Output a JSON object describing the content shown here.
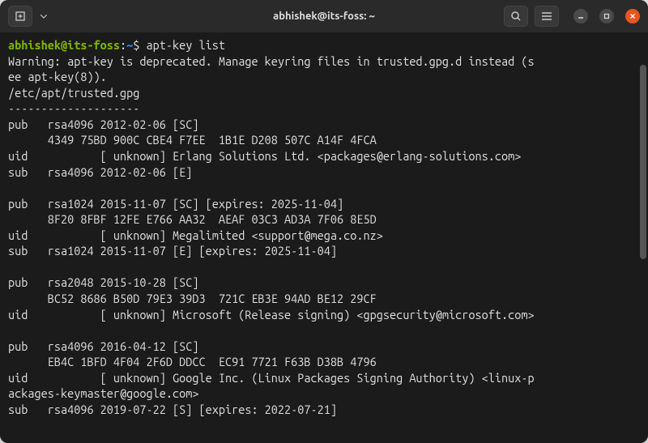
{
  "window": {
    "title": "abhishek@its-foss: ~"
  },
  "prompt": {
    "user_host": "abhishek@its-foss",
    "sep": ":",
    "path": "~",
    "dollar": "$"
  },
  "command": "apt-key list",
  "output_lines": [
    "Warning: apt-key is deprecated. Manage keyring files in trusted.gpg.d instead (s",
    "ee apt-key(8)).",
    "/etc/apt/trusted.gpg",
    "--------------------",
    "pub   rsa4096 2012-02-06 [SC]",
    "      4349 75BD 900C CBE4 F7EE  1B1E D208 507C A14F 4FCA",
    "uid           [ unknown] Erlang Solutions Ltd. <packages@erlang-solutions.com>",
    "sub   rsa4096 2012-02-06 [E]",
    "",
    "pub   rsa1024 2015-11-07 [SC] [expires: 2025-11-04]",
    "      8F20 8FBF 12FE E766 AA32  AEAF 03C3 AD3A 7F06 8E5D",
    "uid           [ unknown] Megalimited <support@mega.co.nz>",
    "sub   rsa1024 2015-11-07 [E] [expires: 2025-11-04]",
    "",
    "pub   rsa2048 2015-10-28 [SC]",
    "      BC52 8686 B50D 79E3 39D3  721C EB3E 94AD BE12 29CF",
    "uid           [ unknown] Microsoft (Release signing) <gpgsecurity@microsoft.com>",
    "",
    "pub   rsa4096 2016-04-12 [SC]",
    "      EB4C 1BFD 4F04 2F6D DDCC  EC91 7721 F63B D38B 4796",
    "uid           [ unknown] Google Inc. (Linux Packages Signing Authority) <linux-p",
    "ackages-keymaster@google.com>",
    "sub   rsa4096 2019-07-22 [S] [expires: 2022-07-21]"
  ]
}
